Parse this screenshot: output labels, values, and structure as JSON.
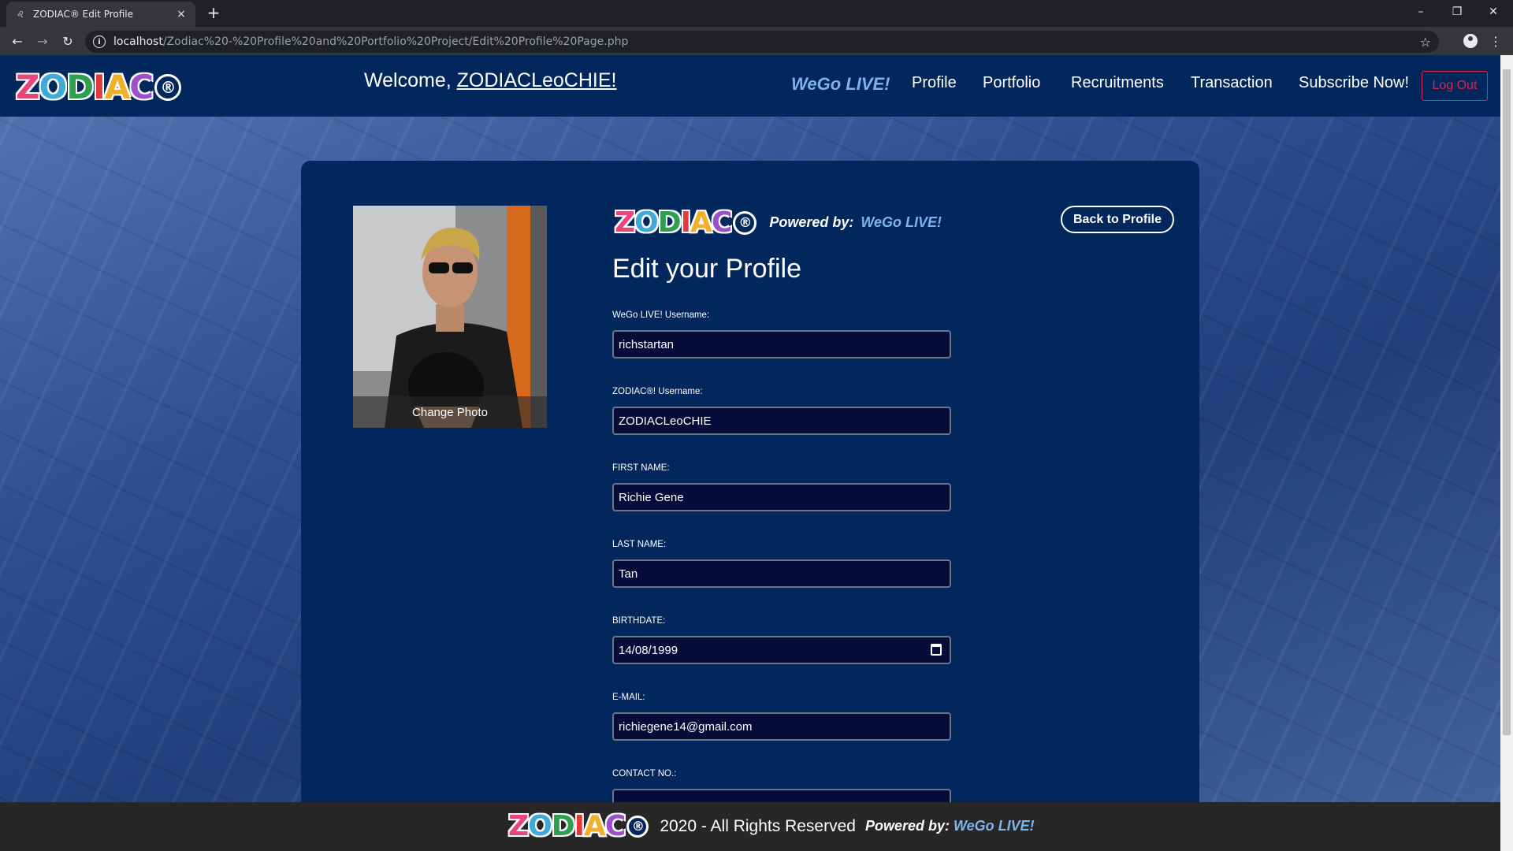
{
  "browser": {
    "tab_title": "ZODIAC® Edit Profile",
    "tab_close": "×",
    "new_tab": "+",
    "url_host": "localhost",
    "url_path": "/Zodiac%20-%20Profile%20and%20Portfolio%20Project/Edit%20Profile%20Page.php",
    "win_minimize": "–",
    "win_restore": "❐",
    "win_close": "✕",
    "back": "←",
    "forward": "→",
    "reload": "↻",
    "star": "☆",
    "menu": "⋮"
  },
  "header": {
    "logo_letters": [
      {
        "ch": "Z",
        "color": "#e8457a"
      },
      {
        "ch": "O",
        "color": "#3fa9d8"
      },
      {
        "ch": "D",
        "color": "#2e9e4f"
      },
      {
        "ch": "I",
        "color": "#e03a3a"
      },
      {
        "ch": "A",
        "color": "#f0b02c"
      },
      {
        "ch": "C",
        "color": "#9b4fc9"
      }
    ],
    "logo_reg": "®",
    "welcome_prefix": "Welcome, ",
    "welcome_user": "ZODIACLeoCHIE!",
    "wego": "WeGo LIVE!",
    "nav": [
      "Profile",
      "Portfolio",
      "Recruitments",
      "Transaction",
      "Subscribe Now!"
    ],
    "logout": "Log Out"
  },
  "card": {
    "change_photo": "Change Photo",
    "powered_by": "Powered by:",
    "wego": "WeGo LIVE!",
    "back_button": "Back to Profile",
    "title": "Edit your Profile",
    "fields": [
      {
        "label": "WeGo LIVE! Username:",
        "value": "richstartan"
      },
      {
        "label": "ZODIAC®! Username:",
        "value": "ZODIACLeoCHIE"
      },
      {
        "label": "FIRST NAME:",
        "value": "Richie Gene"
      },
      {
        "label": "LAST NAME:",
        "value": "Tan"
      },
      {
        "label": "BIRTHDATE:",
        "value": "14/08/1999"
      },
      {
        "label": "E-MAIL:",
        "value": "richiegene14@gmail.com"
      },
      {
        "label": "CONTACT NO.:",
        "value": ""
      }
    ]
  },
  "footer": {
    "text": "2020 - All Rights Reserved",
    "powered_by": "Powered by:",
    "wego": "WeGo LIVE!"
  }
}
